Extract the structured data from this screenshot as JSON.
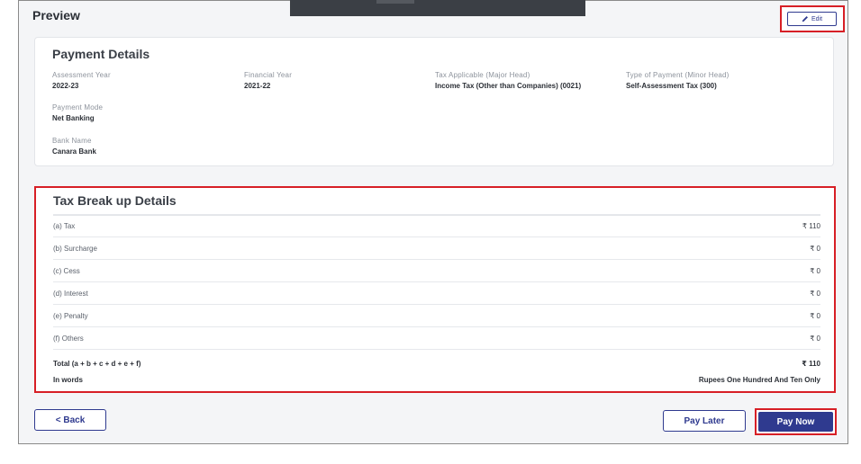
{
  "header": {
    "title": "Preview",
    "edit_label": "Edit"
  },
  "payment_details": {
    "title": "Payment Details",
    "fields": [
      {
        "label": "Assessment Year",
        "value": "2022-23"
      },
      {
        "label": "Financial Year",
        "value": "2021-22"
      },
      {
        "label": "Tax Applicable (Major Head)",
        "value": "Income Tax (Other than Companies) (0021)"
      },
      {
        "label": "Type of Payment (Minor Head)",
        "value": "Self-Assessment Tax (300)"
      },
      {
        "label": "Payment Mode",
        "value": "Net Banking"
      },
      {
        "label": "Bank Name",
        "value": "Canara Bank"
      }
    ]
  },
  "tax_breakup": {
    "title": "Tax Break up Details",
    "rows": [
      {
        "label": "(a) Tax",
        "amount": "₹ 110"
      },
      {
        "label": "(b) Surcharge",
        "amount": "₹ 0"
      },
      {
        "label": "(c) Cess",
        "amount": "₹ 0"
      },
      {
        "label": "(d) Interest",
        "amount": "₹ 0"
      },
      {
        "label": "(e) Penalty",
        "amount": "₹ 0"
      },
      {
        "label": "(f) Others",
        "amount": "₹ 0"
      }
    ],
    "total_label": "Total (a + b + c + d + e + f)",
    "total_amount": "₹ 110",
    "words_label": "In words",
    "words_value": "Rupees One Hundred And Ten Only"
  },
  "footer": {
    "back_label": "< Back",
    "pay_later_label": "Pay Later",
    "pay_now_label": "Pay Now"
  },
  "colors": {
    "accent": "#2f3a8f",
    "highlight": "#d71f26"
  },
  "icons": {
    "edit": "pencil-icon"
  }
}
